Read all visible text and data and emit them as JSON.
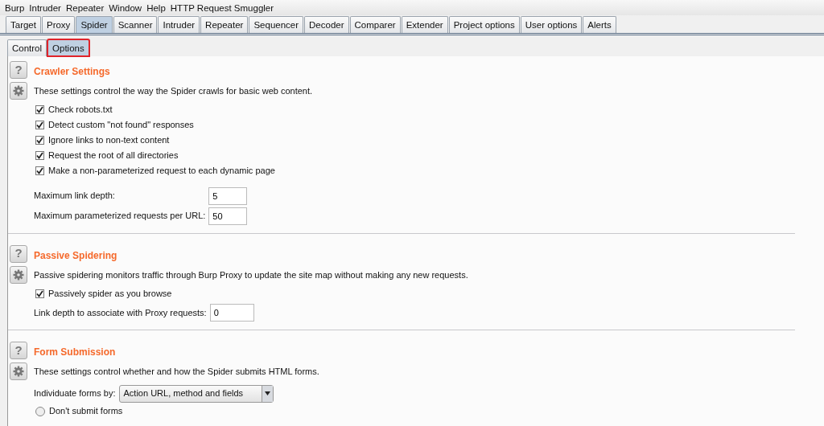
{
  "menu": [
    "Burp",
    "Intruder",
    "Repeater",
    "Window",
    "Help",
    "HTTP Request Smuggler"
  ],
  "tabs": [
    {
      "label": "Target",
      "selected": false
    },
    {
      "label": "Proxy",
      "selected": false
    },
    {
      "label": "Spider",
      "selected": true
    },
    {
      "label": "Scanner",
      "selected": false
    },
    {
      "label": "Intruder",
      "selected": false
    },
    {
      "label": "Repeater",
      "selected": false
    },
    {
      "label": "Sequencer",
      "selected": false
    },
    {
      "label": "Decoder",
      "selected": false
    },
    {
      "label": "Comparer",
      "selected": false
    },
    {
      "label": "Extender",
      "selected": false
    },
    {
      "label": "Project options",
      "selected": false
    },
    {
      "label": "User options",
      "selected": false
    },
    {
      "label": "Alerts",
      "selected": false
    }
  ],
  "subtabs": [
    {
      "label": "Control",
      "selected": false
    },
    {
      "label": "Options",
      "selected": true
    }
  ],
  "sections": [
    {
      "help": "?",
      "title": "Crawler Settings",
      "description": "These settings control the way the Spider crawls for basic web content.",
      "items": [
        {
          "kind": "checkbox",
          "label": "Check robots.txt",
          "checked": true
        },
        {
          "kind": "checkbox",
          "label": "Detect custom \"not found\" responses",
          "checked": true
        },
        {
          "kind": "checkbox",
          "label": "Ignore links to non-text content",
          "checked": true
        },
        {
          "kind": "checkbox",
          "label": "Request the root of all directories",
          "checked": true
        },
        {
          "kind": "checkbox",
          "label": "Make a non-parameterized request to each dynamic page",
          "checked": true
        },
        {
          "kind": "field",
          "label": "Maximum link depth:",
          "value": "5"
        },
        {
          "kind": "field",
          "label": "Maximum parameterized requests per URL:",
          "value": "50"
        }
      ]
    },
    {
      "help": "?",
      "title": "Passive Spidering",
      "description": "Passive spidering monitors traffic through Burp Proxy to update the site map without making any new requests.",
      "items": [
        {
          "kind": "checkbox",
          "label": "Passively spider as you browse",
          "checked": true
        },
        {
          "kind": "field",
          "label": "Link depth to associate with Proxy requests:",
          "value": "0"
        }
      ]
    },
    {
      "help": "?",
      "title": "Form Submission",
      "description": "These settings control whether and how the Spider submits HTML forms.",
      "items": [
        {
          "kind": "select",
          "label": "Individuate forms by:",
          "value": "Action URL, method and fields"
        },
        {
          "kind": "radio",
          "label": "Don't submit forms",
          "selected": false
        }
      ]
    }
  ]
}
